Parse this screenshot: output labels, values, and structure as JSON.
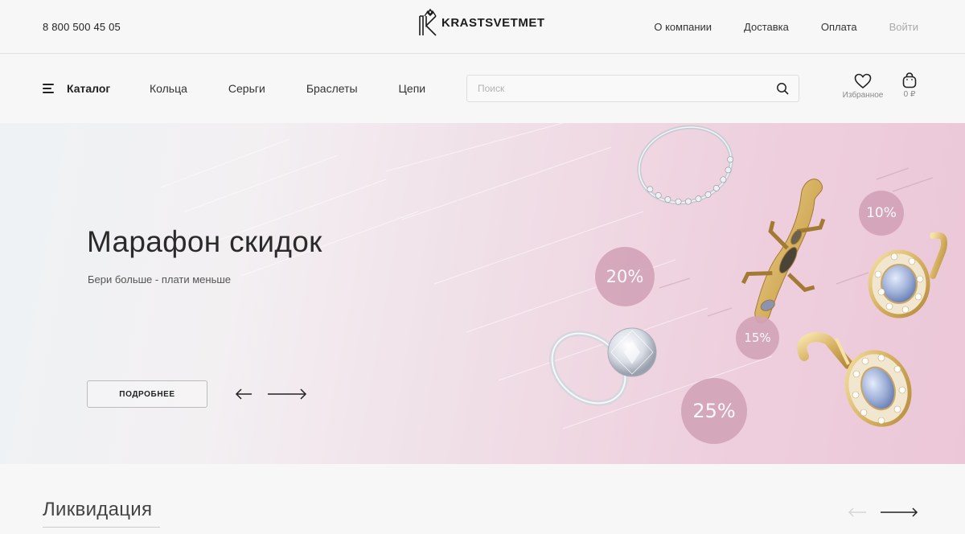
{
  "topbar": {
    "phone": "8 800 500 45 05",
    "logo_text": "KRASTSVETMET",
    "links": [
      "О компании",
      "Доставка",
      "Оплата"
    ],
    "login": "Войти"
  },
  "nav": {
    "catalog_label": "Каталог",
    "links": [
      "Кольца",
      "Серьги",
      "Браслеты",
      "Цепи"
    ],
    "search_placeholder": "Поиск",
    "favorites_label": "Избранное",
    "cart_total": "0 ₽"
  },
  "hero": {
    "title": "Марафон скидок",
    "subtitle": "Бери больше - плати меньше",
    "button_label": "ПОДРОБНЕЕ",
    "badges": [
      "10%",
      "20%",
      "15%",
      "25%"
    ]
  },
  "section": {
    "title": "Ликвидация"
  },
  "colors": {
    "badge": "#d3a3b8",
    "gold": "#d8b46a",
    "text": "#222222"
  },
  "icons": [
    "burger-icon",
    "search-icon",
    "heart-icon",
    "bag-icon",
    "arrow-left-icon",
    "arrow-right-icon"
  ]
}
